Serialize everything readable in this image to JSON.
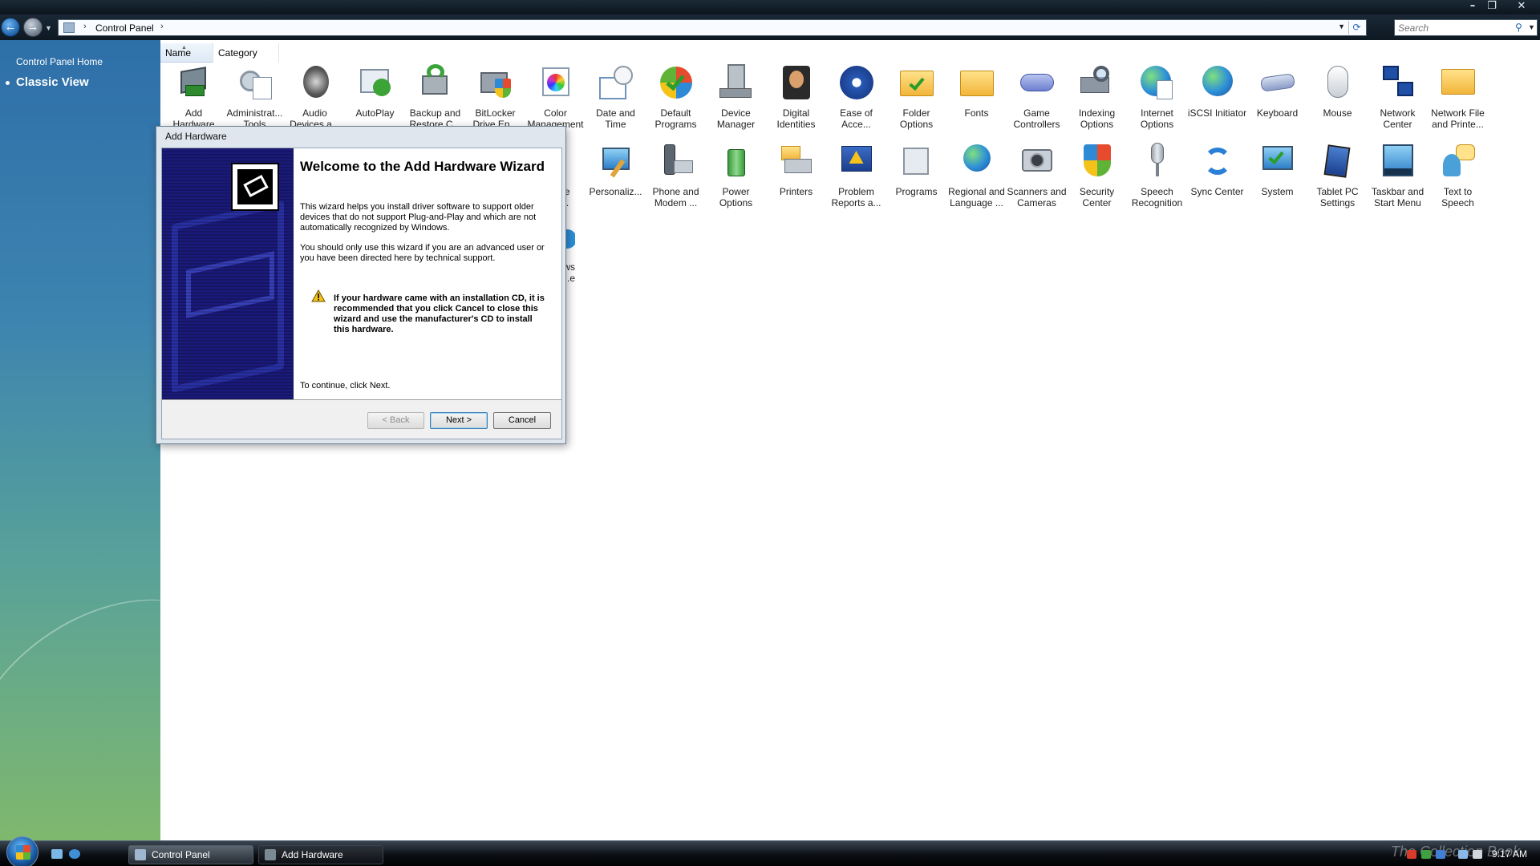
{
  "window": {
    "minimize_icon": "minimize-icon",
    "restore_icon": "restore-icon",
    "close_icon": "close-icon"
  },
  "address_bar": {
    "path": "Control Panel",
    "separator": "›",
    "search_placeholder": "Search"
  },
  "left_pane": {
    "home_link": "Control Panel Home",
    "classic_view": "Classic View"
  },
  "columns": {
    "name": "Name",
    "category": "Category"
  },
  "items": [
    {
      "label": "Add\nHardware",
      "icon": "hardware-icon"
    },
    {
      "label": "Administrat...\nTools",
      "icon": "admin-tools-icon"
    },
    {
      "label": "Audio\nDevices a...",
      "icon": "speaker-icon"
    },
    {
      "label": "AutoPlay",
      "icon": "autoplay-icon"
    },
    {
      "label": "Backup and\nRestore C...",
      "icon": "backup-icon"
    },
    {
      "label": "BitLocker\nDrive En...",
      "icon": "bitlocker-icon"
    },
    {
      "label": "Color\nManagement",
      "icon": "color-icon"
    },
    {
      "label": "Date and\nTime",
      "icon": "clock-icon"
    },
    {
      "label": "Default\nPrograms",
      "icon": "default-programs-icon"
    },
    {
      "label": "Device\nManager",
      "icon": "device-manager-icon"
    },
    {
      "label": "Digital\nIdentities",
      "icon": "identity-icon"
    },
    {
      "label": "Ease of\nAcce...",
      "icon": "ease-of-access-icon"
    },
    {
      "label": "Folder\nOptions",
      "icon": "folder-icon"
    },
    {
      "label": "Fonts",
      "icon": "fonts-folder-icon"
    },
    {
      "label": "Game\nControllers",
      "icon": "gamepad-icon"
    },
    {
      "label": "Indexing\nOptions",
      "icon": "indexing-icon"
    },
    {
      "label": "Internet\nOptions",
      "icon": "internet-icon"
    },
    {
      "label": "iSCSI Initiator",
      "icon": "globe-icon"
    },
    {
      "label": "Keyboard",
      "icon": "keyboard-icon"
    },
    {
      "label": "Mouse",
      "icon": "mouse-icon"
    },
    {
      "label": "Network\nCenter",
      "icon": "network-icon"
    },
    {
      "label": "Network File\nand Printe...",
      "icon": "network-folder-icon"
    },
    {
      "label": "...ance\n...nd...",
      "icon": "performance-icon"
    },
    {
      "label": "Personaliz...",
      "icon": "personalize-icon"
    },
    {
      "label": "Phone and\nModem ...",
      "icon": "phone-icon"
    },
    {
      "label": "Power\nOptions",
      "icon": "power-icon"
    },
    {
      "label": "Printers",
      "icon": "printer-icon"
    },
    {
      "label": "Problem\nReports a...",
      "icon": "problem-reports-icon"
    },
    {
      "label": "Programs",
      "icon": "programs-icon"
    },
    {
      "label": "Regional and\nLanguage ...",
      "icon": "regional-icon"
    },
    {
      "label": "Scanners and\nCameras",
      "icon": "scanner-icon"
    },
    {
      "label": "Security\nCenter",
      "icon": "shield-icon"
    },
    {
      "label": "Speech\nRecognition",
      "icon": "microphone-icon"
    },
    {
      "label": "Sync Center",
      "icon": "sync-icon"
    },
    {
      "label": "System",
      "icon": "system-icon"
    },
    {
      "label": "Tablet PC\nSettings",
      "icon": "tablet-icon"
    },
    {
      "label": "Taskbar and\nStart Menu",
      "icon": "taskbar-icon"
    },
    {
      "label": "Text to\nSpeech",
      "icon": "text-to-speech-icon"
    },
    {
      "label": "...ws\n...e",
      "icon": "windows-update-icon"
    }
  ],
  "dialog": {
    "title": "Add Hardware",
    "heading": "Welcome to the Add Hardware Wizard",
    "para1": "This wizard helps you install driver software to support older devices that do not support Plug-and-Play and which are not automatically recognized by Windows.",
    "para2": "You should only use this wizard if you are an advanced user or you have been directed here by technical support.",
    "warning": "If your hardware came with an installation CD, it is recommended that you click Cancel to close this wizard and use the manufacturer's CD to install this hardware.",
    "continue": "To continue, click Next.",
    "back_label": "< Back",
    "next_label": "Next >",
    "cancel_label": "Cancel"
  },
  "taskbar": {
    "control_panel": "Control Panel",
    "add_hardware": "Add Hardware",
    "watermark": "The Collection Book",
    "clock": "9:17 AM"
  },
  "colors": {
    "accent": "#2f6fb0",
    "warning": "#f4c21b"
  }
}
